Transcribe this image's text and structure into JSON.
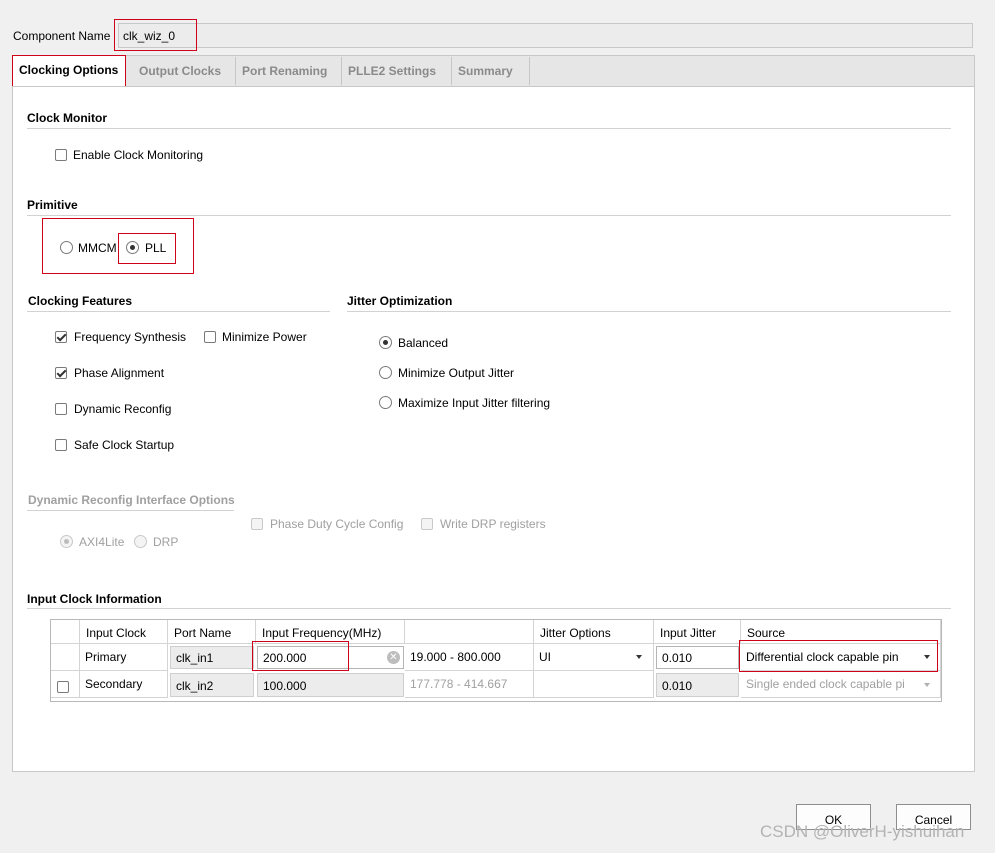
{
  "component": {
    "label": "Component Name",
    "value": "clk_wiz_0"
  },
  "tabs": [
    {
      "label": "Clocking Options",
      "active": true
    },
    {
      "label": "Output Clocks",
      "active": false
    },
    {
      "label": "Port Renaming",
      "active": false
    },
    {
      "label": "PLLE2 Settings",
      "active": false
    },
    {
      "label": "Summary",
      "active": false
    }
  ],
  "clock_monitor": {
    "title": "Clock Monitor",
    "enable_label": "Enable Clock Monitoring",
    "enable_checked": false
  },
  "primitive": {
    "title": "Primitive",
    "options": [
      {
        "label": "MMCM",
        "selected": false
      },
      {
        "label": "PLL",
        "selected": true
      }
    ]
  },
  "clocking_features": {
    "title": "Clocking Features",
    "items": [
      {
        "label": "Frequency Synthesis",
        "checked": true
      },
      {
        "label": "Minimize Power",
        "checked": false
      },
      {
        "label": "Phase Alignment",
        "checked": true
      },
      {
        "label": "Dynamic Reconfig",
        "checked": false
      },
      {
        "label": "Safe Clock Startup",
        "checked": false
      }
    ]
  },
  "jitter_optimization": {
    "title": "Jitter Optimization",
    "options": [
      {
        "label": "Balanced",
        "selected": true
      },
      {
        "label": "Minimize Output Jitter",
        "selected": false
      },
      {
        "label": "Maximize Input Jitter filtering",
        "selected": false
      }
    ]
  },
  "dynamic_reconfig": {
    "title": "Dynamic Reconfig Interface Options",
    "enabled": false,
    "phase_duty_label": "Phase Duty Cycle Config",
    "write_drp_label": "Write DRP registers",
    "interfaces": [
      {
        "label": "AXI4Lite",
        "selected": true
      },
      {
        "label": "DRP",
        "selected": false
      }
    ]
  },
  "input_clock": {
    "title": "Input Clock Information",
    "columns": [
      "Input Clock",
      "Port Name",
      "Input Frequency(MHz)",
      "",
      "Jitter Options",
      "Input Jitter",
      "Source"
    ],
    "rows": [
      {
        "name": "Primary",
        "port": "clk_in1",
        "frequency": "200.000",
        "range": "19.000 - 800.000",
        "jitter_option": "UI",
        "input_jitter": "0.010",
        "source": "Differential clock capable pin"
      },
      {
        "name": "Secondary",
        "port": "clk_in2",
        "frequency": "100.000",
        "range": "177.778 - 414.667",
        "jitter_option": "",
        "input_jitter": "0.010",
        "source": "Single ended clock capable pi",
        "enabled": false
      }
    ]
  },
  "buttons": {
    "ok": "OK",
    "cancel": "Cancel"
  },
  "watermark": "CSDN @OliverH-yishuihan",
  "colors": {
    "highlight": "#d0021b",
    "panel": "#ffffff",
    "background": "#f0f0f0"
  }
}
